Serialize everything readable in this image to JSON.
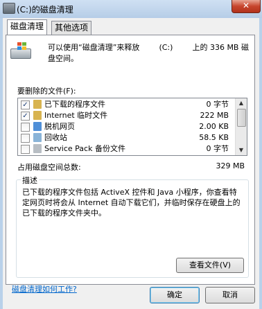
{
  "window": {
    "title": "(C:)的磁盘清理",
    "close_label": "✕"
  },
  "tabs": [
    {
      "label": "磁盘清理",
      "active": true
    },
    {
      "label": "其他选项",
      "active": false
    }
  ],
  "intro": {
    "line1_parts": [
      "可以使用“磁盘清理”来释放",
      "(C:)",
      "上的 336 MB 磁"
    ],
    "line2": "盘空间。"
  },
  "files_label": "要删除的文件(F):",
  "files": [
    {
      "name": "已下载的程序文件",
      "size": "0 字节",
      "checked": true,
      "icon": "folder-icon",
      "icon_color": "#d8b450"
    },
    {
      "name": "Internet 临时文件",
      "size": "222 MB",
      "checked": true,
      "icon": "folder-icon",
      "icon_color": "#d8b450"
    },
    {
      "name": "脱机网页",
      "size": "2.00 KB",
      "checked": false,
      "icon": "offline-webpage-icon",
      "icon_color": "#4f8fd8"
    },
    {
      "name": "回收站",
      "size": "58.5 KB",
      "checked": false,
      "icon": "recycle-bin-icon",
      "icon_color": "#8ab4d8"
    },
    {
      "name": "Service Pack 备份文件",
      "size": "0 字节",
      "checked": false,
      "icon": "backup-file-icon",
      "icon_color": "#b8bec4"
    }
  ],
  "checkmark": "✓",
  "total": {
    "label": "占用磁盘空间总数:",
    "value": "329 MB"
  },
  "description": {
    "legend": "描述",
    "text": "已下载的程序文件包括 ActiveX 控件和 Java 小程序，你查看特定网页时将会从 Internet 自动下载它们，并临时保存在硬盘上的已下载的程序文件夹中。"
  },
  "view_files_button": "查看文件(V)",
  "help_link": "磁盘清理如何工作?",
  "ok_button": "确定",
  "cancel_button": "取消",
  "scroll_up": "▲",
  "scroll_down": "▼",
  "colors": {
    "accent_link": "#0066cc",
    "window_frame": "#b9d1ea",
    "close_button": "#c7452d"
  }
}
